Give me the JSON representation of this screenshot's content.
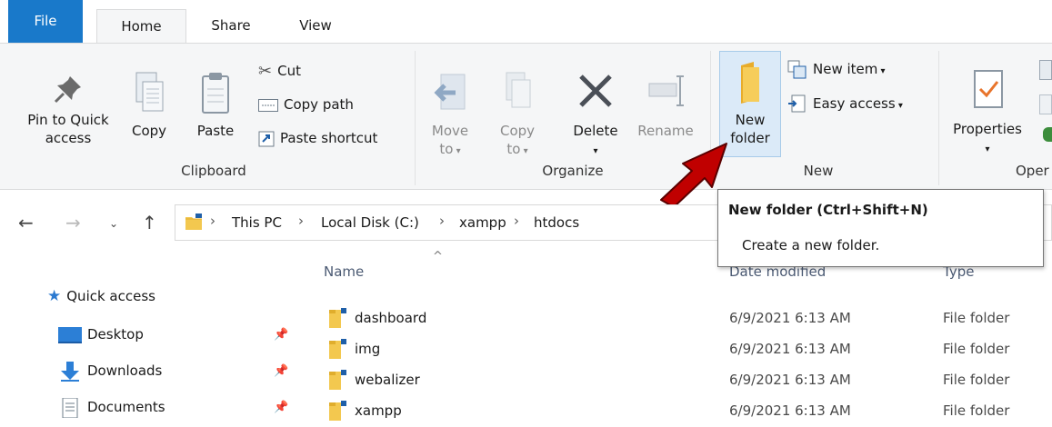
{
  "tabs": {
    "file": "File",
    "home": "Home",
    "share": "Share",
    "view": "View"
  },
  "clipboard": {
    "pin_line1": "Pin to Quick",
    "pin_line2": "access",
    "copy": "Copy",
    "paste": "Paste",
    "cut": "Cut",
    "copy_path": "Copy path",
    "paste_shortcut": "Paste shortcut",
    "group": "Clipboard"
  },
  "organize": {
    "move_line1": "Move",
    "move_line2": "to",
    "copy_line1": "Copy",
    "copy_line2": "to",
    "delete": "Delete",
    "rename": "Rename",
    "group": "Organize"
  },
  "new_group": {
    "new_folder_line1": "New",
    "new_folder_line2": "folder",
    "new_item": "New item",
    "easy_access": "Easy access",
    "group": "New"
  },
  "open_group": {
    "properties": "Properties",
    "group": "Oper"
  },
  "breadcrumb": [
    "This PC",
    "Local Disk (C:)",
    "xampp",
    "htdocs"
  ],
  "tooltip": {
    "title": "New folder (Ctrl+Shift+N)",
    "description": "Create a new folder."
  },
  "columns": {
    "name": "Name",
    "date": "Date modified",
    "type": "Type"
  },
  "sidebar": {
    "items": [
      {
        "label": "Quick access",
        "icon": "star-icon"
      },
      {
        "label": "Desktop",
        "icon": "desktop-icon",
        "pinned": true
      },
      {
        "label": "Downloads",
        "icon": "download-arrow-icon",
        "pinned": true
      },
      {
        "label": "Documents",
        "icon": "documents-icon",
        "pinned": true
      }
    ]
  },
  "files": [
    {
      "name": "dashboard",
      "date": "6/9/2021 6:13 AM",
      "type": "File folder"
    },
    {
      "name": "img",
      "date": "6/9/2021 6:13 AM",
      "type": "File folder"
    },
    {
      "name": "webalizer",
      "date": "6/9/2021 6:13 AM",
      "type": "File folder"
    },
    {
      "name": "xampp",
      "date": "6/9/2021 6:13 AM",
      "type": "File folder"
    }
  ],
  "colors": {
    "accent": "#1979ca",
    "arrow": "#c00000",
    "folder": "#f3c84f"
  }
}
